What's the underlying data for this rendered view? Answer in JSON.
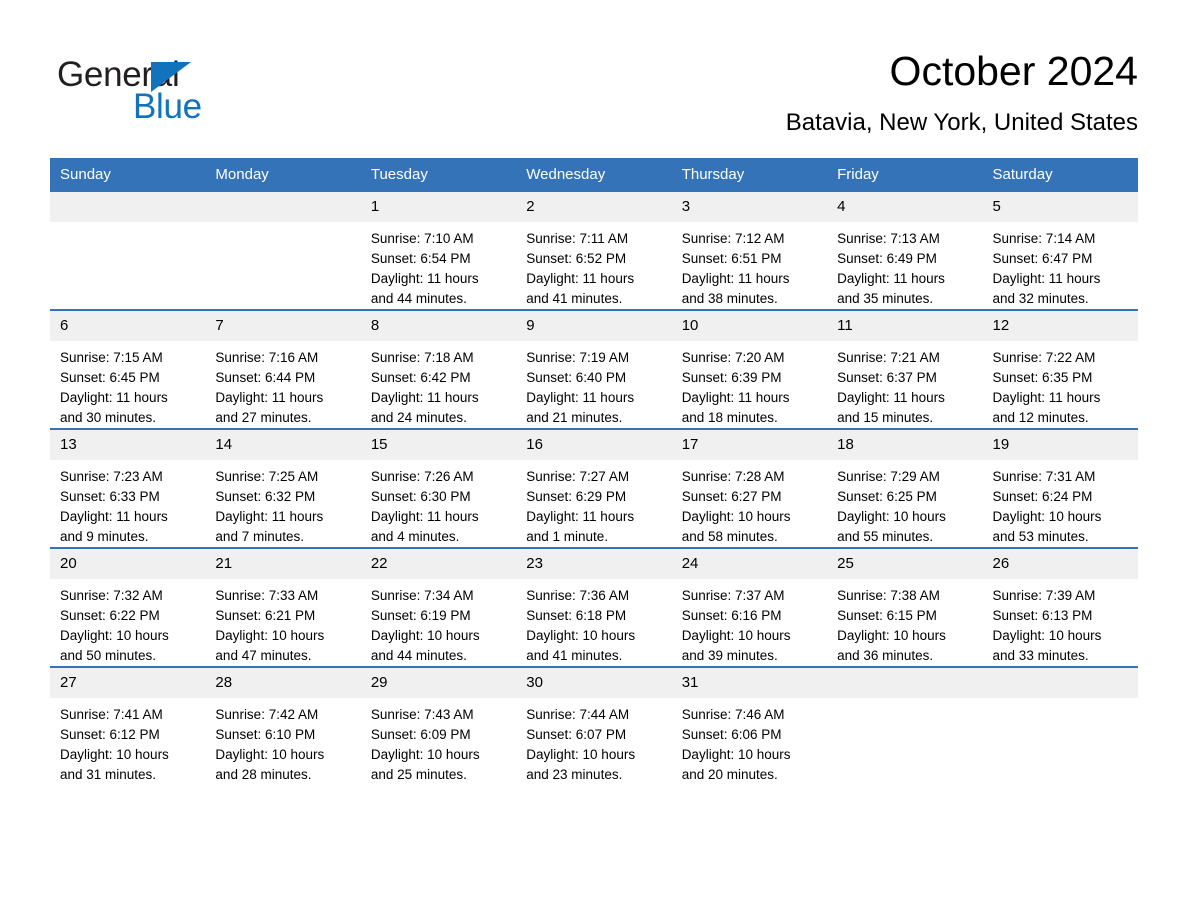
{
  "logo": {
    "word_top": "General",
    "word_bottom": "Blue",
    "accent_color": "#1073bb"
  },
  "header": {
    "month_title": "October 2024",
    "location": "Batavia, New York, United States"
  },
  "theme": {
    "header_blue": "#3573b9",
    "daynum_band": "#f0f0f0",
    "text": "#000000"
  },
  "calendar": {
    "weekday_headers": [
      "Sunday",
      "Monday",
      "Tuesday",
      "Wednesday",
      "Thursday",
      "Friday",
      "Saturday"
    ],
    "weeks": [
      [
        {
          "day": "",
          "sunrise": "",
          "sunset": "",
          "daylight_line1": "",
          "daylight_line2": ""
        },
        {
          "day": "",
          "sunrise": "",
          "sunset": "",
          "daylight_line1": "",
          "daylight_line2": ""
        },
        {
          "day": "1",
          "sunrise": "Sunrise: 7:10 AM",
          "sunset": "Sunset: 6:54 PM",
          "daylight_line1": "Daylight: 11 hours",
          "daylight_line2": "and 44 minutes."
        },
        {
          "day": "2",
          "sunrise": "Sunrise: 7:11 AM",
          "sunset": "Sunset: 6:52 PM",
          "daylight_line1": "Daylight: 11 hours",
          "daylight_line2": "and 41 minutes."
        },
        {
          "day": "3",
          "sunrise": "Sunrise: 7:12 AM",
          "sunset": "Sunset: 6:51 PM",
          "daylight_line1": "Daylight: 11 hours",
          "daylight_line2": "and 38 minutes."
        },
        {
          "day": "4",
          "sunrise": "Sunrise: 7:13 AM",
          "sunset": "Sunset: 6:49 PM",
          "daylight_line1": "Daylight: 11 hours",
          "daylight_line2": "and 35 minutes."
        },
        {
          "day": "5",
          "sunrise": "Sunrise: 7:14 AM",
          "sunset": "Sunset: 6:47 PM",
          "daylight_line1": "Daylight: 11 hours",
          "daylight_line2": "and 32 minutes."
        }
      ],
      [
        {
          "day": "6",
          "sunrise": "Sunrise: 7:15 AM",
          "sunset": "Sunset: 6:45 PM",
          "daylight_line1": "Daylight: 11 hours",
          "daylight_line2": "and 30 minutes."
        },
        {
          "day": "7",
          "sunrise": "Sunrise: 7:16 AM",
          "sunset": "Sunset: 6:44 PM",
          "daylight_line1": "Daylight: 11 hours",
          "daylight_line2": "and 27 minutes."
        },
        {
          "day": "8",
          "sunrise": "Sunrise: 7:18 AM",
          "sunset": "Sunset: 6:42 PM",
          "daylight_line1": "Daylight: 11 hours",
          "daylight_line2": "and 24 minutes."
        },
        {
          "day": "9",
          "sunrise": "Sunrise: 7:19 AM",
          "sunset": "Sunset: 6:40 PM",
          "daylight_line1": "Daylight: 11 hours",
          "daylight_line2": "and 21 minutes."
        },
        {
          "day": "10",
          "sunrise": "Sunrise: 7:20 AM",
          "sunset": "Sunset: 6:39 PM",
          "daylight_line1": "Daylight: 11 hours",
          "daylight_line2": "and 18 minutes."
        },
        {
          "day": "11",
          "sunrise": "Sunrise: 7:21 AM",
          "sunset": "Sunset: 6:37 PM",
          "daylight_line1": "Daylight: 11 hours",
          "daylight_line2": "and 15 minutes."
        },
        {
          "day": "12",
          "sunrise": "Sunrise: 7:22 AM",
          "sunset": "Sunset: 6:35 PM",
          "daylight_line1": "Daylight: 11 hours",
          "daylight_line2": "and 12 minutes."
        }
      ],
      [
        {
          "day": "13",
          "sunrise": "Sunrise: 7:23 AM",
          "sunset": "Sunset: 6:33 PM",
          "daylight_line1": "Daylight: 11 hours",
          "daylight_line2": "and 9 minutes."
        },
        {
          "day": "14",
          "sunrise": "Sunrise: 7:25 AM",
          "sunset": "Sunset: 6:32 PM",
          "daylight_line1": "Daylight: 11 hours",
          "daylight_line2": "and 7 minutes."
        },
        {
          "day": "15",
          "sunrise": "Sunrise: 7:26 AM",
          "sunset": "Sunset: 6:30 PM",
          "daylight_line1": "Daylight: 11 hours",
          "daylight_line2": "and 4 minutes."
        },
        {
          "day": "16",
          "sunrise": "Sunrise: 7:27 AM",
          "sunset": "Sunset: 6:29 PM",
          "daylight_line1": "Daylight: 11 hours",
          "daylight_line2": "and 1 minute."
        },
        {
          "day": "17",
          "sunrise": "Sunrise: 7:28 AM",
          "sunset": "Sunset: 6:27 PM",
          "daylight_line1": "Daylight: 10 hours",
          "daylight_line2": "and 58 minutes."
        },
        {
          "day": "18",
          "sunrise": "Sunrise: 7:29 AM",
          "sunset": "Sunset: 6:25 PM",
          "daylight_line1": "Daylight: 10 hours",
          "daylight_line2": "and 55 minutes."
        },
        {
          "day": "19",
          "sunrise": "Sunrise: 7:31 AM",
          "sunset": "Sunset: 6:24 PM",
          "daylight_line1": "Daylight: 10 hours",
          "daylight_line2": "and 53 minutes."
        }
      ],
      [
        {
          "day": "20",
          "sunrise": "Sunrise: 7:32 AM",
          "sunset": "Sunset: 6:22 PM",
          "daylight_line1": "Daylight: 10 hours",
          "daylight_line2": "and 50 minutes."
        },
        {
          "day": "21",
          "sunrise": "Sunrise: 7:33 AM",
          "sunset": "Sunset: 6:21 PM",
          "daylight_line1": "Daylight: 10 hours",
          "daylight_line2": "and 47 minutes."
        },
        {
          "day": "22",
          "sunrise": "Sunrise: 7:34 AM",
          "sunset": "Sunset: 6:19 PM",
          "daylight_line1": "Daylight: 10 hours",
          "daylight_line2": "and 44 minutes."
        },
        {
          "day": "23",
          "sunrise": "Sunrise: 7:36 AM",
          "sunset": "Sunset: 6:18 PM",
          "daylight_line1": "Daylight: 10 hours",
          "daylight_line2": "and 41 minutes."
        },
        {
          "day": "24",
          "sunrise": "Sunrise: 7:37 AM",
          "sunset": "Sunset: 6:16 PM",
          "daylight_line1": "Daylight: 10 hours",
          "daylight_line2": "and 39 minutes."
        },
        {
          "day": "25",
          "sunrise": "Sunrise: 7:38 AM",
          "sunset": "Sunset: 6:15 PM",
          "daylight_line1": "Daylight: 10 hours",
          "daylight_line2": "and 36 minutes."
        },
        {
          "day": "26",
          "sunrise": "Sunrise: 7:39 AM",
          "sunset": "Sunset: 6:13 PM",
          "daylight_line1": "Daylight: 10 hours",
          "daylight_line2": "and 33 minutes."
        }
      ],
      [
        {
          "day": "27",
          "sunrise": "Sunrise: 7:41 AM",
          "sunset": "Sunset: 6:12 PM",
          "daylight_line1": "Daylight: 10 hours",
          "daylight_line2": "and 31 minutes."
        },
        {
          "day": "28",
          "sunrise": "Sunrise: 7:42 AM",
          "sunset": "Sunset: 6:10 PM",
          "daylight_line1": "Daylight: 10 hours",
          "daylight_line2": "and 28 minutes."
        },
        {
          "day": "29",
          "sunrise": "Sunrise: 7:43 AM",
          "sunset": "Sunset: 6:09 PM",
          "daylight_line1": "Daylight: 10 hours",
          "daylight_line2": "and 25 minutes."
        },
        {
          "day": "30",
          "sunrise": "Sunrise: 7:44 AM",
          "sunset": "Sunset: 6:07 PM",
          "daylight_line1": "Daylight: 10 hours",
          "daylight_line2": "and 23 minutes."
        },
        {
          "day": "31",
          "sunrise": "Sunrise: 7:46 AM",
          "sunset": "Sunset: 6:06 PM",
          "daylight_line1": "Daylight: 10 hours",
          "daylight_line2": "and 20 minutes."
        },
        {
          "day": "",
          "sunrise": "",
          "sunset": "",
          "daylight_line1": "",
          "daylight_line2": ""
        },
        {
          "day": "",
          "sunrise": "",
          "sunset": "",
          "daylight_line1": "",
          "daylight_line2": ""
        }
      ]
    ]
  }
}
